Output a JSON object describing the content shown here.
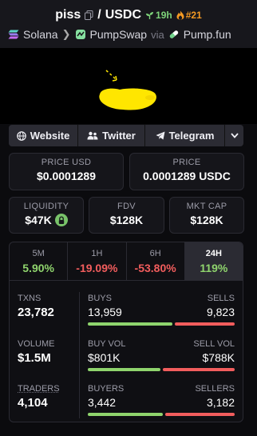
{
  "header": {
    "token": "piss",
    "separator": "/",
    "quote": "USDC",
    "age": "19h",
    "rank": "#21"
  },
  "chain": {
    "network": "Solana",
    "dex": "PumpSwap",
    "via": "via",
    "launchpad": "Pump.fun"
  },
  "socials": {
    "website": "Website",
    "twitter": "Twitter",
    "telegram": "Telegram"
  },
  "price": {
    "usd_label": "PRICE USD",
    "usd_value": "$0.0001289",
    "native_label": "PRICE",
    "native_value": "0.0001289 USDC"
  },
  "metrics": {
    "liquidity_label": "LIQUIDITY",
    "liquidity_value": "$47K",
    "fdv_label": "FDV",
    "fdv_value": "$128K",
    "mcap_label": "MKT CAP",
    "mcap_value": "$128K"
  },
  "timeframes": [
    {
      "label": "5M",
      "value": "5.90%",
      "trend": "up"
    },
    {
      "label": "1H",
      "value": "-19.09%",
      "trend": "down"
    },
    {
      "label": "6H",
      "value": "-53.80%",
      "trend": "down"
    },
    {
      "label": "24H",
      "value": "119%",
      "trend": "up",
      "active": true
    }
  ],
  "stats": {
    "txns_label": "TXNS",
    "txns_value": "23,782",
    "buys_label": "BUYS",
    "buys_value": "13,959",
    "sells_label": "SELLS",
    "sells_value": "9,823",
    "buys_share": 0.587,
    "volume_label": "VOLUME",
    "volume_value": "$1.5M",
    "buy_vol_label": "BUY VOL",
    "buy_vol_value": "$801K",
    "sell_vol_label": "SELL VOL",
    "sell_vol_value": "$788K",
    "buy_vol_share": 0.504,
    "traders_label": "TRADERS",
    "traders_value": "4,104",
    "buyers_label": "BUYERS",
    "buyers_value": "3,442",
    "sellers_label": "SELLERS",
    "sellers_value": "3,182",
    "buyers_share": 0.52
  },
  "colors": {
    "positive": "#8fd46d",
    "negative": "#f25d5d",
    "age": "#7ed37a",
    "rank": "#f59a23",
    "banner_blob": "#ffe600"
  }
}
